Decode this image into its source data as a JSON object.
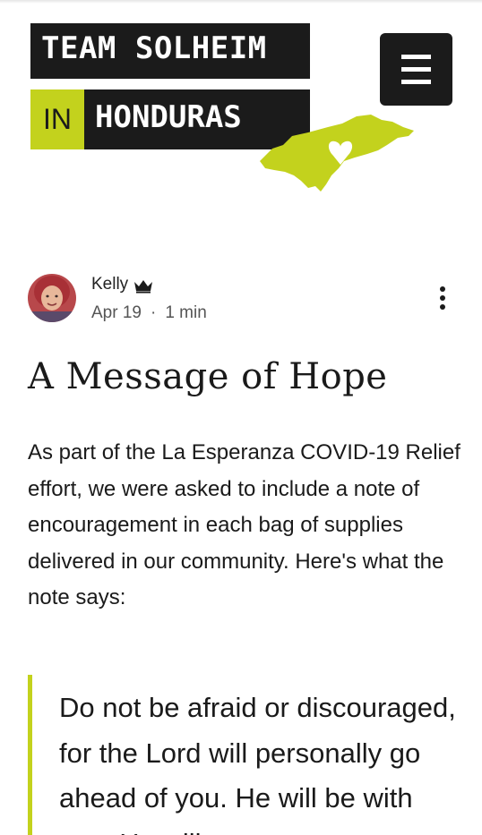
{
  "header": {
    "logo": {
      "line1": "TEAM SOLHEIM",
      "in_label": "IN",
      "line2": "HONDURAS"
    },
    "menu_icon": "hamburger-icon"
  },
  "post": {
    "author": {
      "name": "Kelly",
      "badge_icon": "crown-icon"
    },
    "date": "Apr 19",
    "separator": "·",
    "read_time": "1 min",
    "more_icon": "more-vertical-icon",
    "title": "A Message of Hope",
    "body": "As part of the La Esperanza COVID-19 Relief effort, we were asked to include a note of encouragement in each bag of supplies delivered in our community. Here's what the note says:",
    "quote": "Do not be afraid or discouraged, for the Lord will personally go ahead of you. He will be with you; He will"
  },
  "colors": {
    "accent_lime": "#c3d21d",
    "logo_black": "#1b1b1b",
    "text": "#1a1a1a",
    "meta_text": "#555555"
  }
}
